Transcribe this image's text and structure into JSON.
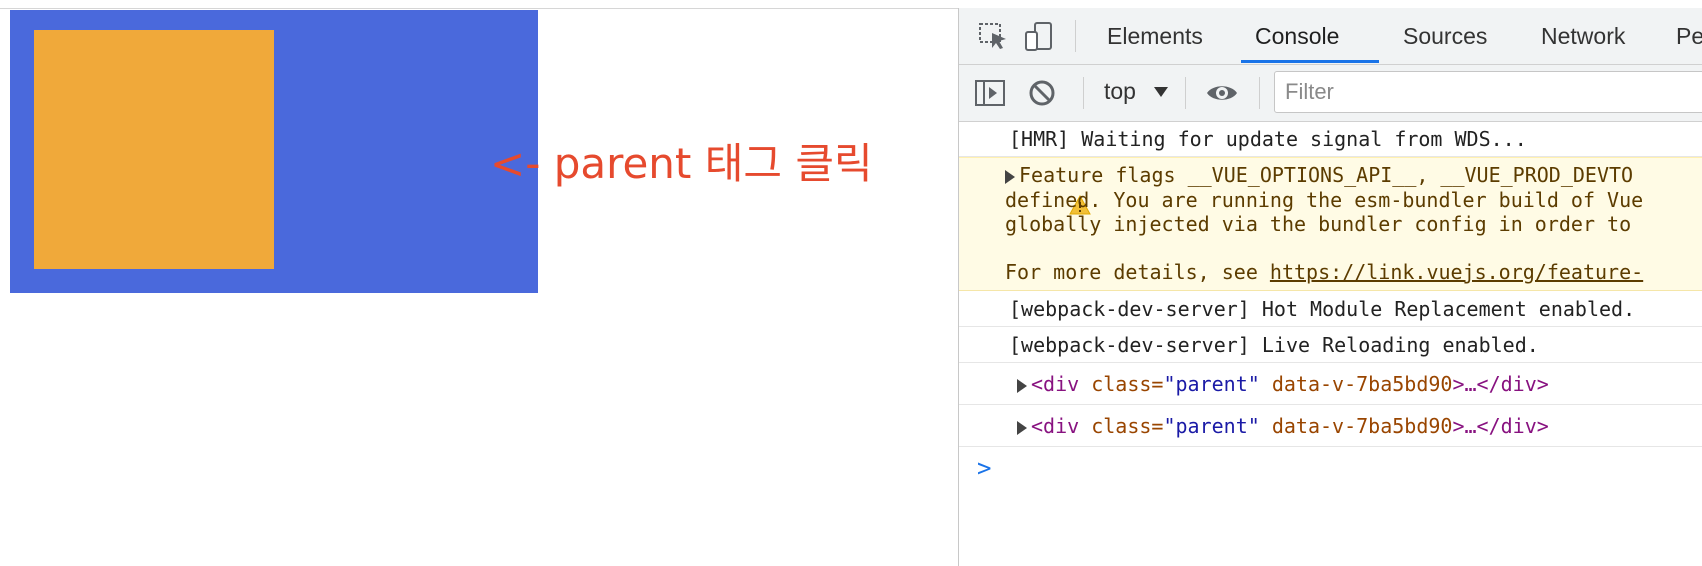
{
  "page": {
    "annotation": "<- parent 태그 클릭"
  },
  "devtools": {
    "tabs": [
      "Elements",
      "Console",
      "Sources",
      "Network",
      "Pe"
    ],
    "active_tab": "Console",
    "context": "top",
    "filter_placeholder": "Filter",
    "icons": [
      "inspect-element-icon",
      "device-toolbar-icon",
      "sidebar-toggle-icon",
      "clear-console-icon",
      "live-expression-eye-icon",
      "warning-icon",
      "chevron-right-prompt-icon"
    ],
    "accent_color": "#1a73e8"
  },
  "console": {
    "hmr": "[HMR] Waiting for update signal from WDS...",
    "warning": {
      "line1": "Feature flags __VUE_OPTIONS_API__, __VUE_PROD_DEVTO",
      "line2": "defined. You are running the esm-bundler build of Vue",
      "line3": "globally injected via the bundler config in order to",
      "line4_prefix": "For more details, see ",
      "line4_link": "https://link.vuejs.org/feature-"
    },
    "wds_hot": "[webpack-dev-server] Hot Module Replacement enabled.",
    "wds_live": "[webpack-dev-server] Live Reloading enabled.",
    "elements": [
      {
        "open": "<div",
        "attr_class": " class=",
        "class_value": "\"parent\"",
        "attr_data": " data-v-7ba5bd90",
        "close": ">…</div>"
      },
      {
        "open": "<div",
        "attr_class": " class=",
        "class_value": "\"parent\"",
        "attr_data": " data-v-7ba5bd90",
        "close": ">…</div>"
      }
    ],
    "prompt": ">"
  },
  "colors": {
    "parent_box": "#4a69dc",
    "child_box": "#f0a93a",
    "annotation": "#e64a2e"
  }
}
